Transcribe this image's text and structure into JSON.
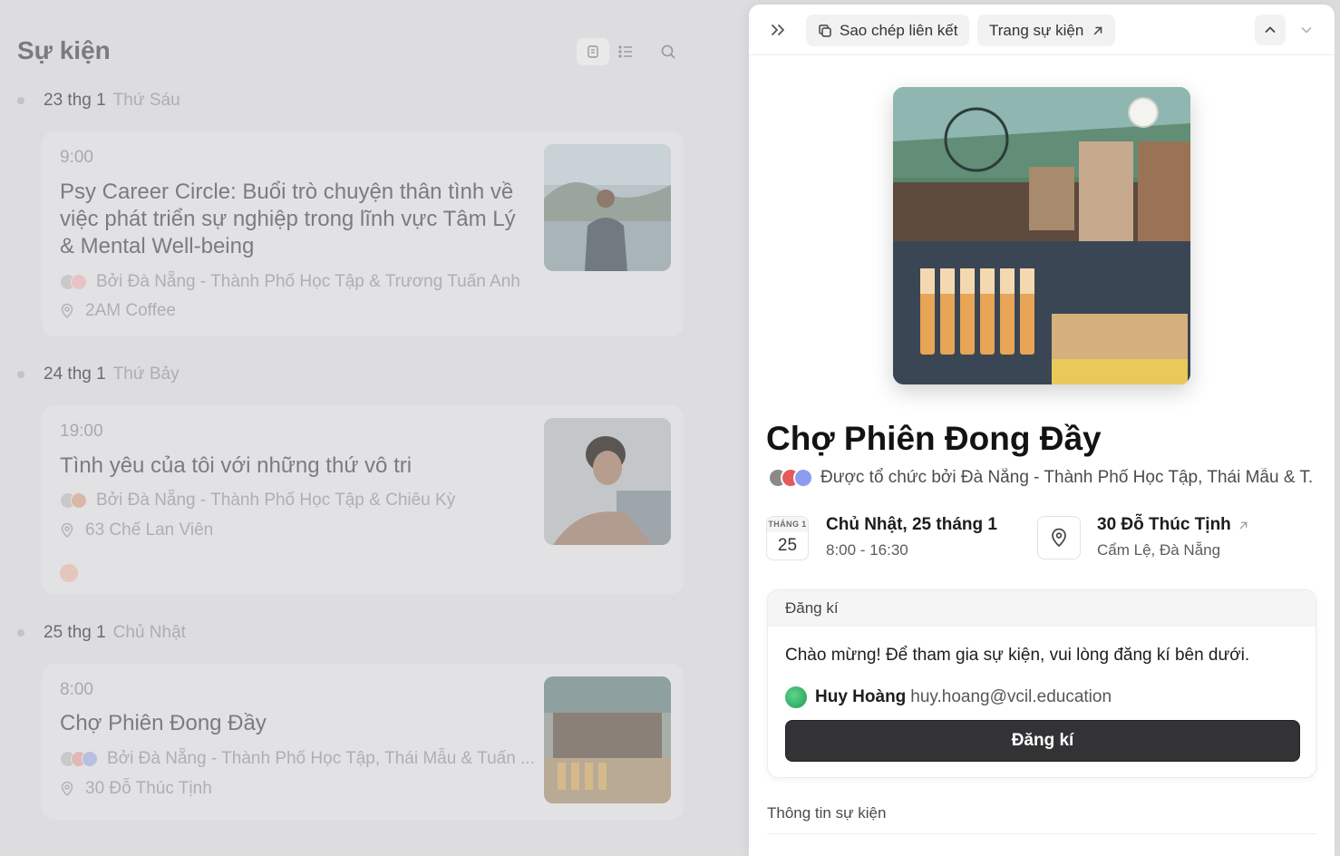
{
  "left": {
    "title": "Sự kiện",
    "days": [
      {
        "date": "23 thg 1",
        "weekday": "Thứ Sáu",
        "event": {
          "time": "9:00",
          "title": "Psy Career Circle: Buổi trò chuyện thân tình về việc phát triển sự nghiệp trong lĩnh vực Tâm Lý & Mental Well-being",
          "hosts": "Bởi Đà Nẵng - Thành Phố Học Tập & Trương Tuấn Anh",
          "location": "2AM Coffee"
        }
      },
      {
        "date": "24 thg 1",
        "weekday": "Thứ Bảy",
        "event": {
          "time": "19:00",
          "title": "Tình yêu của tôi với những thứ vô tri",
          "hosts": "Bởi Đà Nẵng - Thành Phố Học Tập & Chiêu Kỳ",
          "location": "63 Chế Lan Viên"
        }
      },
      {
        "date": "25 thg 1",
        "weekday": "Chủ Nhật",
        "event": {
          "time": "8:00",
          "title": "Chợ Phiên Đong Đầy",
          "hosts": "Bởi Đà Nẵng - Thành Phố Học Tập, Thái Mẫu & Tuấn ...",
          "location": "30 Đỗ Thúc Tịnh"
        }
      }
    ]
  },
  "panel": {
    "copy_link_label": "Sao chép liên kết",
    "event_page_label": "Trang sự kiện",
    "title": "Chợ Phiên Đong Đầy",
    "hosted_by": "Được tổ chức bởi Đà Nẵng - Thành Phố Học Tập, Thái Mẫu & T...",
    "calendar_month": "THÁNG 1",
    "calendar_day": "25",
    "date_text": "Chủ Nhật, 25 tháng 1",
    "time_text": "8:00 - 16:30",
    "location_name": "30 Đỗ Thúc Tịnh",
    "location_area": "Cẩm Lệ, Đà Nẵng",
    "registration": {
      "header": "Đăng kí",
      "message": "Chào mừng! Để tham gia sự kiện, vui lòng đăng kí bên dưới.",
      "user_name": "Huy Hoàng",
      "user_email": "huy.hoang@vcil.education",
      "button_label": "Đăng kí"
    },
    "info_header": "Thông tin sự kiện"
  },
  "colors": {
    "accent_button": "#333336",
    "background_dim": "#dddddf"
  }
}
